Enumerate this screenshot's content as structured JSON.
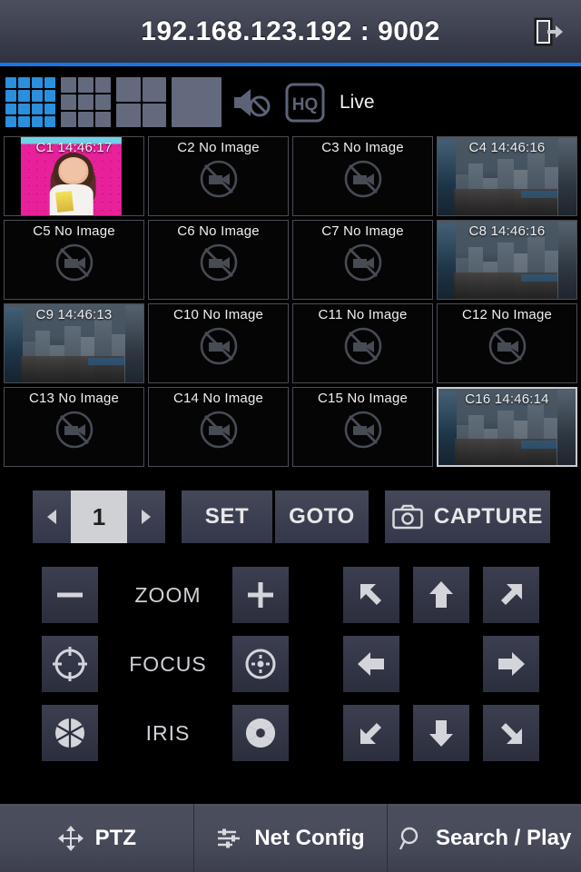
{
  "titlebar": {
    "address": "192.168.123.192 : 9002",
    "logout_icon": "logout-icon"
  },
  "toolbar": {
    "layouts": [
      {
        "name": "layout-16-split",
        "cells": 16,
        "cols": 4,
        "active": true
      },
      {
        "name": "layout-9-split",
        "cells": 9,
        "cols": 3,
        "active": false
      },
      {
        "name": "layout-4-split",
        "cells": 4,
        "cols": 2,
        "active": false
      },
      {
        "name": "layout-1-split",
        "cells": 1,
        "cols": 1,
        "active": false
      }
    ],
    "mute_icon": "speaker-mute-icon",
    "hq_label": "HQ",
    "live_label": "Live"
  },
  "grid": {
    "channels": [
      {
        "label": "C1 14:46:17",
        "scene": "pop",
        "selected": false
      },
      {
        "label": "C2 No Image",
        "scene": "none",
        "selected": false
      },
      {
        "label": "C3 No Image",
        "scene": "none",
        "selected": false
      },
      {
        "label": "C4 14:46:16",
        "scene": "city",
        "selected": false
      },
      {
        "label": "C5 No Image",
        "scene": "none",
        "selected": false
      },
      {
        "label": "C6 No Image",
        "scene": "none",
        "selected": false
      },
      {
        "label": "C7 No Image",
        "scene": "none",
        "selected": false
      },
      {
        "label": "C8 14:46:16",
        "scene": "city",
        "selected": false
      },
      {
        "label": "C9 14:46:13",
        "scene": "city",
        "selected": false
      },
      {
        "label": "C10 No Image",
        "scene": "none",
        "selected": false
      },
      {
        "label": "C11 No Image",
        "scene": "none",
        "selected": false
      },
      {
        "label": "C12 No Image",
        "scene": "none",
        "selected": false
      },
      {
        "label": "C13 No Image",
        "scene": "none",
        "selected": false
      },
      {
        "label": "C14 No Image",
        "scene": "none",
        "selected": false
      },
      {
        "label": "C15 No Image",
        "scene": "none",
        "selected": false
      },
      {
        "label": "C16 14:46:14",
        "scene": "city",
        "selected": true
      }
    ]
  },
  "controls": {
    "prev_icon": "triangle-left-icon",
    "next_icon": "triangle-right-icon",
    "page_number": "1",
    "set_label": "SET",
    "goto_label": "GOTO",
    "capture_label": "CAPTURE",
    "capture_icon": "camera-icon",
    "zoom_label": "ZOOM",
    "focus_label": "FOCUS",
    "iris_label": "IRIS",
    "zoom_out_icon": "minus-icon",
    "zoom_in_icon": "plus-icon",
    "focus_near_icon": "focus-near-icon",
    "focus_far_icon": "focus-far-icon",
    "iris_close_icon": "iris-closed-icon",
    "iris_open_icon": "iris-open-icon",
    "pad": [
      {
        "name": "pan-up-left-button",
        "icon": "arrow-up-left-icon"
      },
      {
        "name": "pan-up-button",
        "icon": "arrow-up-icon"
      },
      {
        "name": "pan-up-right-button",
        "icon": "arrow-up-right-icon"
      },
      {
        "name": "pan-left-button",
        "icon": "arrow-left-icon"
      },
      {
        "name": "pan-right-button",
        "icon": "arrow-right-icon"
      },
      {
        "name": "pan-down-left-button",
        "icon": "arrow-down-left-icon"
      },
      {
        "name": "pan-down-button",
        "icon": "arrow-down-icon"
      },
      {
        "name": "pan-down-right-button",
        "icon": "arrow-down-right-icon"
      }
    ]
  },
  "tabbar": {
    "tabs": [
      {
        "label": "PTZ",
        "icon": "move-icon"
      },
      {
        "label": "Net Config",
        "icon": "sliders-icon"
      },
      {
        "label": "Search / Play",
        "icon": "magnifier-icon"
      }
    ]
  },
  "colors": {
    "accent_blue": "#1874e8",
    "active_layout": "#2a8fdc",
    "panel_dark": "#3c3f50",
    "title_gradient_top": "#4c4f5e"
  }
}
